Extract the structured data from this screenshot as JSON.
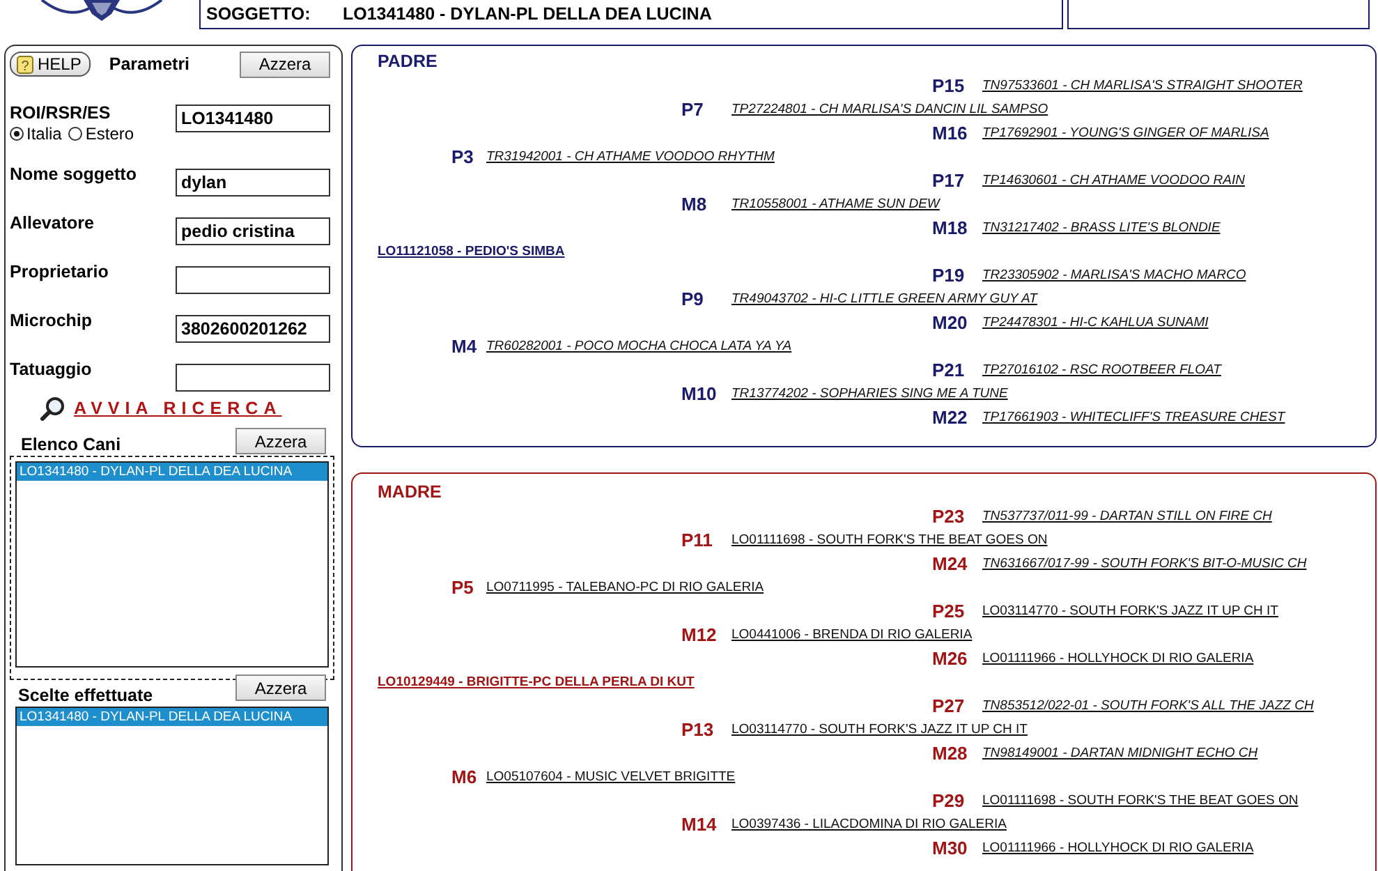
{
  "header": {
    "label": "SOGGETTO:",
    "value": "LO1341480 - DYLAN-PL DELLA DEA LUCINA"
  },
  "search_panel": {
    "help_icon": "?",
    "help_button": "HELP",
    "title": "Parametri",
    "reset_button": "Azzera",
    "fields": [
      {
        "label": "ROI/RSR/ES",
        "value": "LO1341480",
        "options": [
          {
            "label": "Italia",
            "selected": true
          },
          {
            "label": "Estero",
            "selected": false
          }
        ]
      },
      {
        "label": "Nome soggetto",
        "value": "dylan"
      },
      {
        "label": "Allevatore",
        "value": "pedio cristina"
      },
      {
        "label": "Proprietario"
      },
      {
        "label": "Microchip",
        "value": "3802600201262"
      },
      {
        "label": "Tatuaggio"
      }
    ],
    "search_link": "AVVIA RICERCA",
    "dog_list": {
      "title": "Elenco Cani",
      "reset_button": "Azzera",
      "items": [
        {
          "text": "LO1341480 - DYLAN-PL DELLA DEA LUCINA",
          "selected": true
        }
      ]
    },
    "choices": {
      "title": "Scelte effettuate",
      "reset_button": "Azzera",
      "items": [
        {
          "text": "LO1341480 - DYLAN-PL DELLA DEA LUCINA",
          "selected": true
        }
      ]
    }
  },
  "pedigree": [
    {
      "kind": "sire",
      "title": "PADRE",
      "root": {
        "text": "LO11121058 - PEDIO'S SIMBA",
        "italic": false,
        "children": [
          {
            "label": "P3",
            "text": "TR31942001 - CH ATHAME VOODOO RHYTHM",
            "italic": true,
            "children": [
              {
                "label": "P7",
                "text": "TP27224801 - CH MARLISA'S DANCIN LIL SAMPSO",
                "italic": true,
                "children": [
                  {
                    "label": "P15",
                    "text": "TN97533601 - CH MARLISA'S STRAIGHT SHOOTER",
                    "italic": true
                  },
                  {
                    "label": "M16",
                    "text": "TP17692901 - YOUNG'S GINGER OF MARLISA",
                    "italic": true
                  }
                ]
              },
              {
                "label": "M8",
                "text": "TR10558001 - ATHAME SUN DEW",
                "italic": true,
                "children": [
                  {
                    "label": "P17",
                    "text": "TP14630601 - CH ATHAME VOODOO RAIN",
                    "italic": true
                  },
                  {
                    "label": "M18",
                    "text": "TN31217402 - BRASS LITE'S BLONDIE",
                    "italic": true
                  }
                ]
              }
            ]
          },
          {
            "label": "M4",
            "text": "TR60282001 - POCO MOCHA CHOCA LATA YA YA",
            "italic": true,
            "children": [
              {
                "label": "P9",
                "text": "TR49043702 - HI-C LITTLE GREEN ARMY GUY AT",
                "italic": true,
                "children": [
                  {
                    "label": "P19",
                    "text": "TR23305902 - MARLISA'S MACHO MARCO",
                    "italic": true
                  },
                  {
                    "label": "M20",
                    "text": "TP24478301 - HI-C KAHLUA SUNAMI",
                    "italic": true
                  }
                ]
              },
              {
                "label": "M10",
                "text": "TR13774202 - SOPHARIES SING ME A TUNE",
                "italic": true,
                "children": [
                  {
                    "label": "P21",
                    "text": "TP27016102 - RSC ROOTBEER FLOAT",
                    "italic": true
                  },
                  {
                    "label": "M22",
                    "text": "TP17661903 - WHITECLIFF'S TREASURE CHEST",
                    "italic": true
                  }
                ]
              }
            ]
          }
        ]
      }
    },
    {
      "kind": "dam",
      "title": "MADRE",
      "root": {
        "text": "LO10129449 - BRIGITTE-PC DELLA PERLA DI KUT",
        "italic": false,
        "children": [
          {
            "label": "P5",
            "text": "LO0711995 - TALEBANO-PC DI RIO GALERIA",
            "italic": false,
            "children": [
              {
                "label": "P11",
                "text": "LO01111698 - SOUTH FORK'S THE BEAT GOES ON",
                "italic": false,
                "children": [
                  {
                    "label": "P23",
                    "text": "TN537737/011-99 - DARTAN STILL ON FIRE CH",
                    "italic": true
                  },
                  {
                    "label": "M24",
                    "text": "TN631667/017-99 - SOUTH FORK'S BIT-O-MUSIC CH",
                    "italic": true
                  }
                ]
              },
              {
                "label": "M12",
                "text": "LO0441006 - BRENDA DI RIO GALERIA",
                "italic": false,
                "children": [
                  {
                    "label": "P25",
                    "text": "LO03114770 - SOUTH FORK'S JAZZ IT UP CH IT",
                    "italic": false
                  },
                  {
                    "label": "M26",
                    "text": "LO01111966 - HOLLYHOCK DI RIO GALERIA",
                    "italic": false
                  }
                ]
              }
            ]
          },
          {
            "label": "M6",
            "text": "LO05107604 - MUSIC VELVET BRIGITTE",
            "italic": false,
            "children": [
              {
                "label": "P13",
                "text": "LO03114770 - SOUTH FORK'S JAZZ IT UP CH IT",
                "italic": false,
                "children": [
                  {
                    "label": "P27",
                    "text": "TN853512/022-01 - SOUTH FORK'S ALL THE JAZZ CH",
                    "italic": true
                  },
                  {
                    "label": "M28",
                    "text": "TN98149001 - DARTAN MIDNIGHT ECHO CH",
                    "italic": true
                  }
                ]
              },
              {
                "label": "M14",
                "text": "LO0397436 - LILACDOMINA DI RIO GALERIA",
                "italic": false,
                "children": [
                  {
                    "label": "P29",
                    "text": "LO01111698 - SOUTH FORK'S THE BEAT GOES ON",
                    "italic": false
                  },
                  {
                    "label": "M30",
                    "text": "LO01111966 - HOLLYHOCK DI RIO GALERIA",
                    "italic": false
                  }
                ]
              }
            ]
          }
        ]
      }
    }
  ]
}
